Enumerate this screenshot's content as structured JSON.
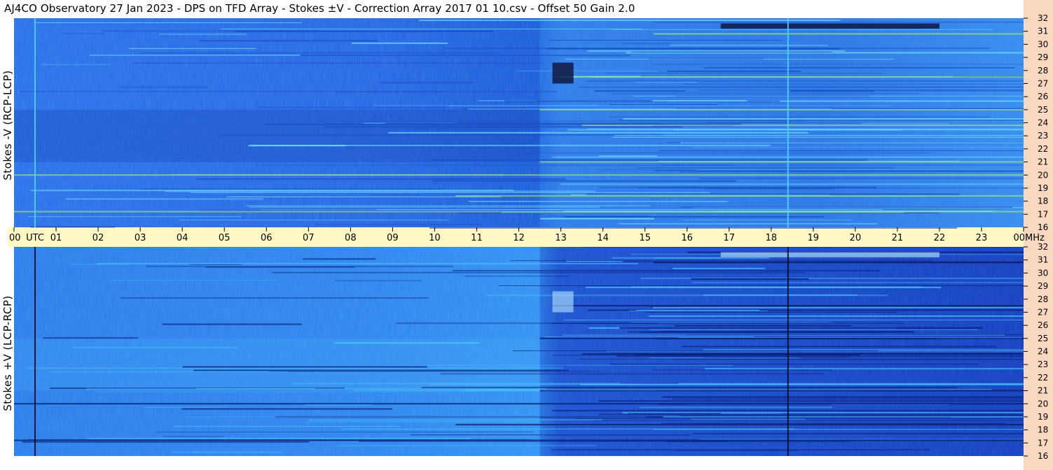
{
  "header": {
    "title": "AJ4CO Observatory  27 Jan 2023  -  DPS on TFD Array  -  Stokes ±V  -  Correction Array 2017 01 10.csv  -  Offset 50  Gain 2.0"
  },
  "colors": {
    "freq_strip": "#f8d8c0",
    "time_strip": "#fff8c4",
    "quiet_background": "#2a6ee6",
    "dark_band": "#0a2a8a",
    "bright_band": "#5ad8ff"
  },
  "chart_data": {
    "type": "heatmap",
    "time_axis": {
      "unit_label": "UTC",
      "labels": [
        "00",
        "01",
        "02",
        "03",
        "04",
        "05",
        "06",
        "07",
        "08",
        "09",
        "10",
        "11",
        "12",
        "13",
        "14",
        "15",
        "16",
        "17",
        "18",
        "19",
        "20",
        "21",
        "22",
        "23",
        "00"
      ],
      "range_hours": [
        0,
        24
      ]
    },
    "freq_axis": {
      "unit_label": "MHz",
      "labels": [
        "32",
        "31",
        "30",
        "29",
        "28",
        "27",
        "26",
        "25",
        "24",
        "23",
        "22",
        "21",
        "20",
        "19",
        "18",
        "17",
        "16"
      ],
      "range_mhz": [
        16,
        32
      ]
    },
    "panels": [
      {
        "ylabel": "Stokes -V (RCP-LCP)",
        "polarity": "-V"
      },
      {
        "ylabel": "Stokes +V (LCP-RCP)",
        "polarity": "+V"
      }
    ],
    "vertical_markers_utc_hours": [
      0.5,
      18.4
    ],
    "strong_rfi_bands_mhz": [
      {
        "freq": 25.0,
        "start": 12.5,
        "end": 24
      },
      {
        "freq": 20.0,
        "start": 0,
        "end": 24
      },
      {
        "freq": 17.2,
        "start": 0,
        "end": 24
      },
      {
        "freq": 18.4,
        "start": 10.5,
        "end": 24
      },
      {
        "freq": 21.0,
        "start": 12.5,
        "end": 24
      },
      {
        "freq": 23.8,
        "start": 13.5,
        "end": 24
      },
      {
        "freq": 27.5,
        "start": 12.8,
        "end": 24
      },
      {
        "freq": 30.8,
        "start": 15.2,
        "end": 24
      }
    ],
    "events": [
      {
        "freq_range": [
          31.2,
          31.6
        ],
        "time_range": [
          16.8,
          22.0
        ],
        "note": ""
      },
      {
        "freq_range": [
          27.0,
          28.6
        ],
        "time_range": [
          12.8,
          13.3
        ],
        "note": ""
      }
    ]
  }
}
